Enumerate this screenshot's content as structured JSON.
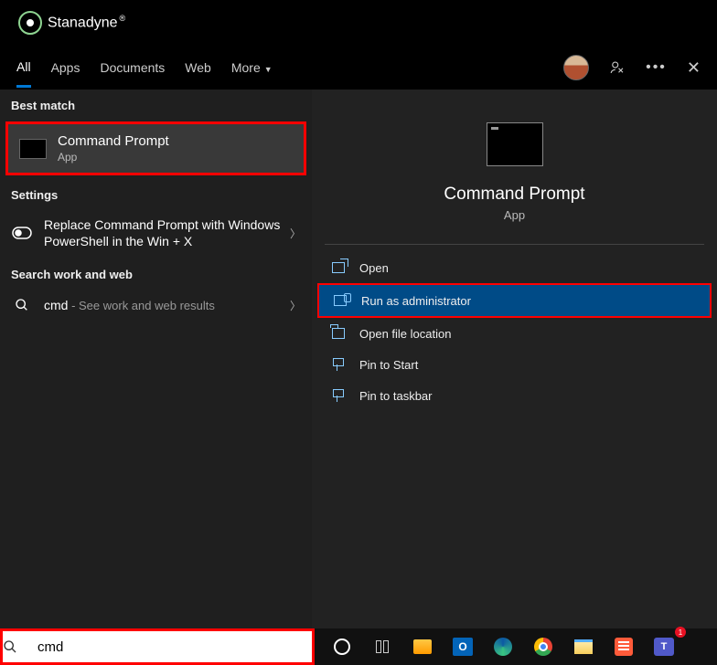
{
  "brand": {
    "name": "Stanadyne"
  },
  "tabs": {
    "all": "All",
    "apps": "Apps",
    "documents": "Documents",
    "web": "Web",
    "more": "More"
  },
  "left": {
    "best_match": "Best match",
    "result": {
      "title": "Command Prompt",
      "subtitle": "App"
    },
    "settings": "Settings",
    "setting_item": "Replace Command Prompt with Windows PowerShell in the Win + X",
    "search_ww": "Search work and web",
    "cmd_main": "cmd",
    "cmd_hint": " - See work and web results"
  },
  "preview": {
    "title": "Command Prompt",
    "subtitle": "App"
  },
  "actions": {
    "open": "Open",
    "run_admin": "Run as administrator",
    "open_file": "Open file location",
    "pin_start": "Pin to Start",
    "pin_taskbar": "Pin to taskbar"
  },
  "search": {
    "value": "cmd"
  },
  "taskbar": {
    "outlook": "O",
    "teams": "T"
  }
}
